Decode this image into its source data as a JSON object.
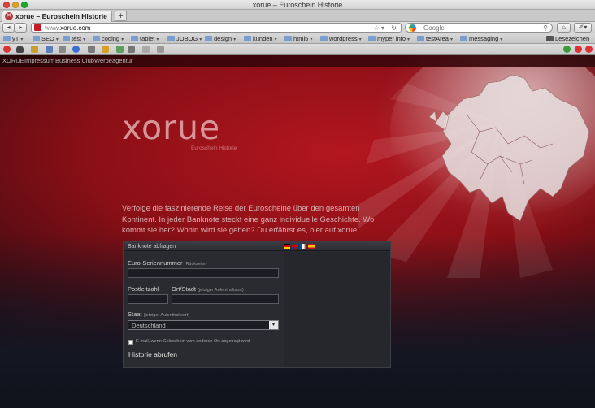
{
  "window": {
    "title": "xorue – Euroschein Historie",
    "tab_label": "xorue – Euroschein Historie",
    "new_tab": "+"
  },
  "navbar": {
    "back": "◂",
    "forward": "▸",
    "url_prefix": "www.",
    "url_host": "xorue.com",
    "search_placeholder": "Google",
    "home": "⌂",
    "reading_list_label": "Lesezeichen"
  },
  "bookmarks": [
    {
      "label": "yT"
    },
    {
      "label": "SEO"
    },
    {
      "label": "test"
    },
    {
      "label": "coding"
    },
    {
      "label": "tablet"
    },
    {
      "label": "JOBOG"
    },
    {
      "label": "design"
    },
    {
      "label": "kunden"
    },
    {
      "label": "html5"
    },
    {
      "label": "wordpress"
    },
    {
      "label": "myper info"
    },
    {
      "label": "testArea"
    },
    {
      "label": "messaging"
    }
  ],
  "site_nav": [
    "XORUE",
    "Impressum",
    "Business Club",
    "Werbeagentur"
  ],
  "hero": {
    "logo": "xorue",
    "logo_sub": "Euroschein Historie",
    "intro": "Verfolge die faszinierende Reise der Euroscheine über den gesamten Kontinent. In jeder Banknote steckt eine ganz individuelle Geschichte. Wo kommt sie her? Wohin wird sie gehen? Du erfährst es, hier auf xorue."
  },
  "form": {
    "title": "Banknote abfragen",
    "serial_label": "Euro-Seriennummer",
    "serial_hint": "(Rückseite)",
    "zip_label": "Postleitzahl",
    "city_label": "Ort/Stadt",
    "city_hint": "(jetziger Aufenthaltsort)",
    "state_label": "Staat",
    "state_hint": "(jetziger Aufenthaltsort)",
    "state_value": "Deutschland",
    "notify_label": "E-mail, wenn Geldschein vom anderen Ort abgefragt wird.",
    "submit": "Historie abrufen"
  }
}
